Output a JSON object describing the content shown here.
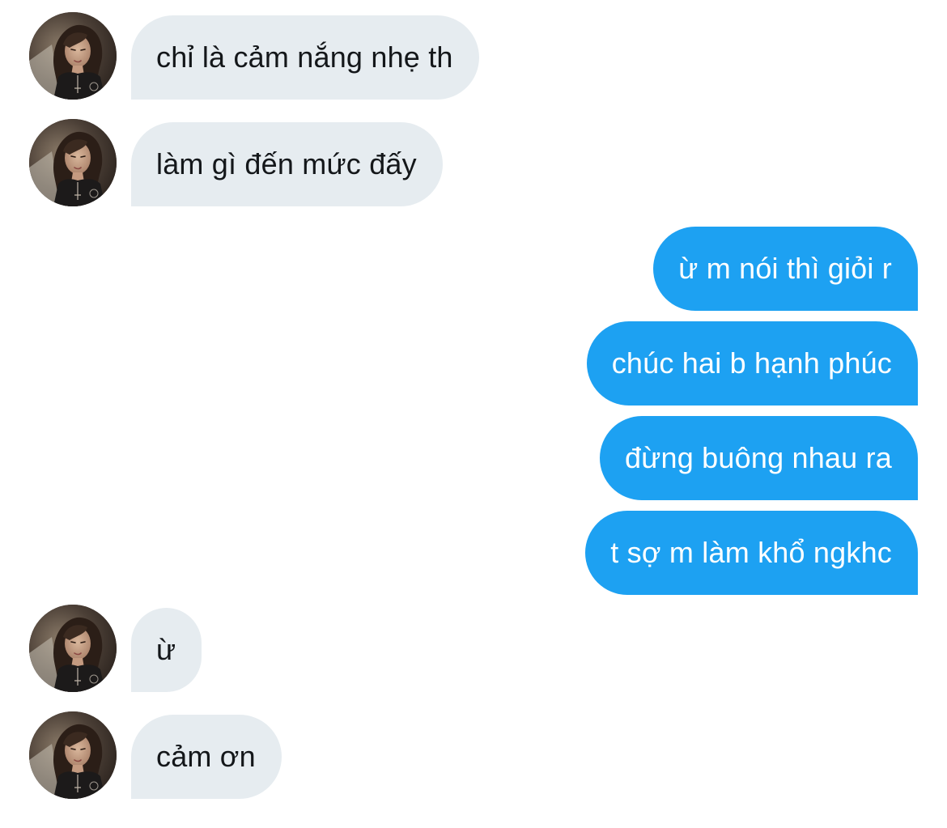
{
  "colors": {
    "incoming_bubble": "#e6ecf0",
    "incoming_text": "#14171a",
    "outgoing_bubble": "#1da1f2",
    "outgoing_text": "#ffffff",
    "background": "#ffffff"
  },
  "avatar_icon": "user-photo-avatar",
  "messages": [
    {
      "sender": "other",
      "text": "chỉ là cảm nắng nhẹ th"
    },
    {
      "sender": "other",
      "text": "làm gì đến mức đấy"
    },
    {
      "sender": "me",
      "text": "ừ m nói thì giỏi r"
    },
    {
      "sender": "me",
      "text": "chúc hai b hạnh phúc"
    },
    {
      "sender": "me",
      "text": "đừng buông nhau ra"
    },
    {
      "sender": "me",
      "text": "t sợ m làm khổ ngkhc"
    },
    {
      "sender": "other",
      "text": "ừ"
    },
    {
      "sender": "other",
      "text": "cảm ơn"
    }
  ]
}
